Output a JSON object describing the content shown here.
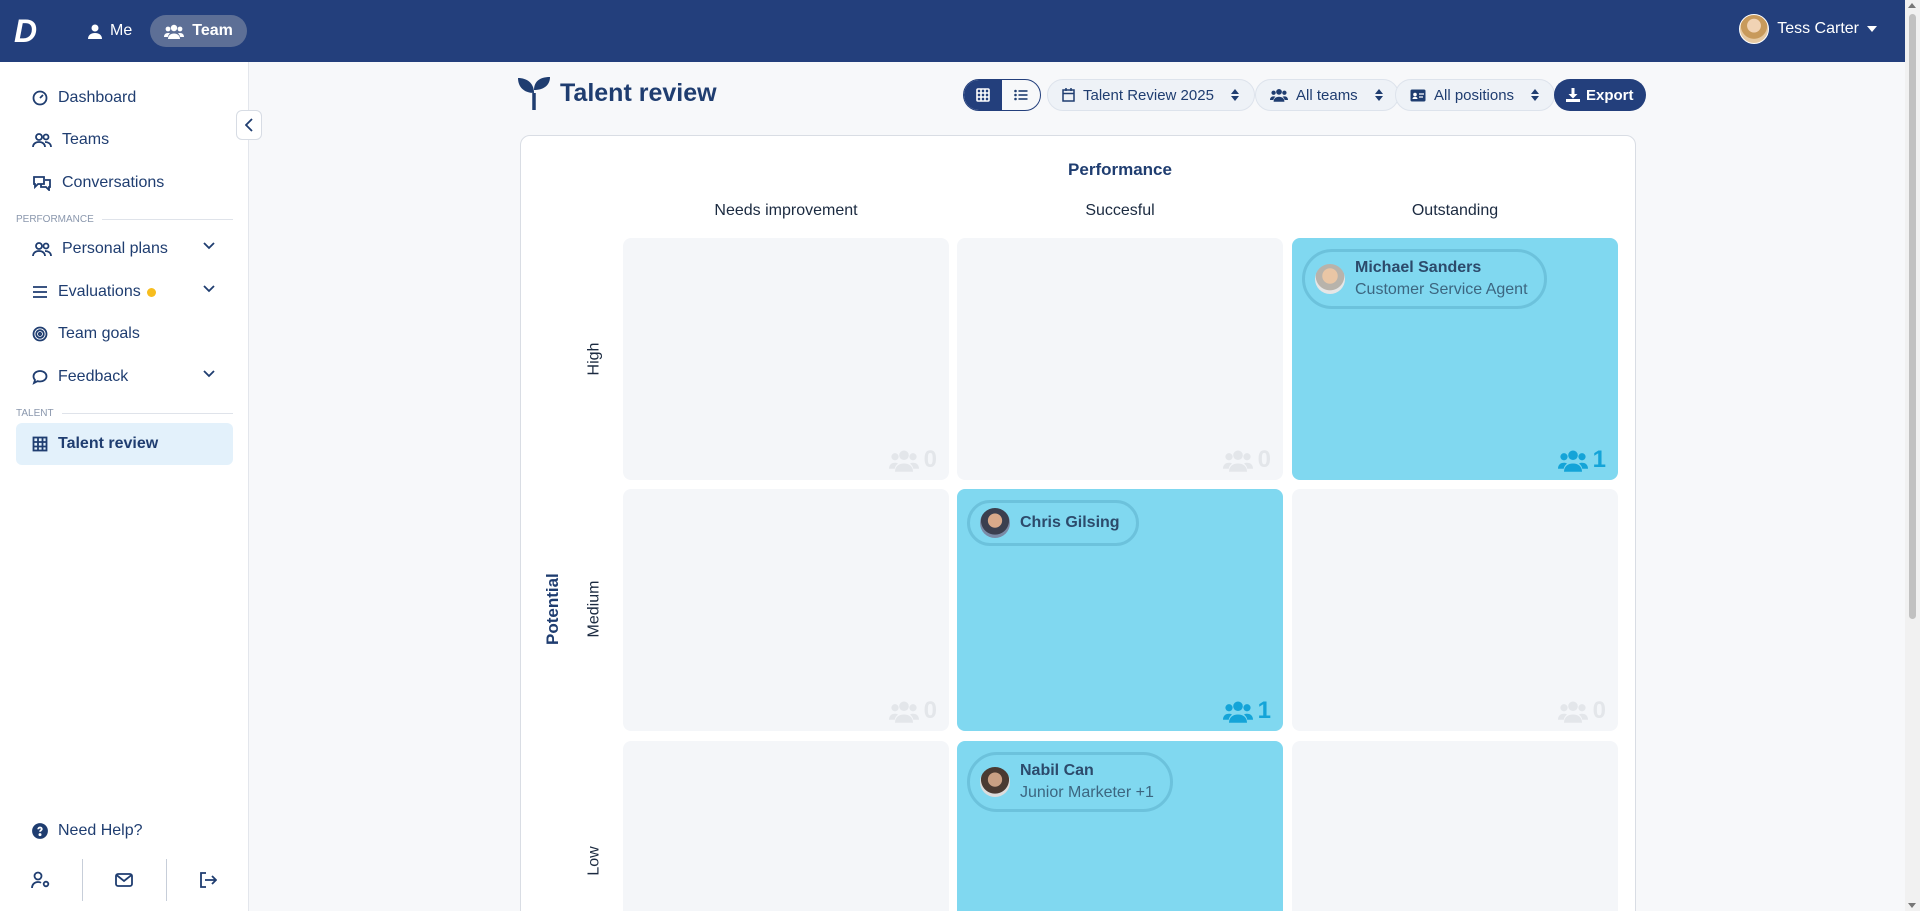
{
  "topbar": {
    "logo": "D",
    "nav": [
      {
        "label": "Me"
      },
      {
        "label": "Team"
      }
    ],
    "user_name": "Tess Carter"
  },
  "sidebar": {
    "items": [
      {
        "label": "Dashboard",
        "icon": "dashboard-icon"
      },
      {
        "label": "Teams",
        "icon": "teams-icon"
      },
      {
        "label": "Conversations",
        "icon": "conversations-icon"
      }
    ],
    "section_performance": "PERFORMANCE",
    "performance_items": [
      {
        "label": "Personal plans",
        "icon": "personal-plans-icon",
        "expandable": true
      },
      {
        "label": "Evaluations",
        "icon": "list-icon",
        "expandable": true,
        "notification": true
      },
      {
        "label": "Team goals",
        "icon": "target-icon"
      },
      {
        "label": "Feedback",
        "icon": "chat-icon",
        "expandable": true
      }
    ],
    "section_talent": "TALENT",
    "talent_items": [
      {
        "label": "Talent review",
        "icon": "grid-icon",
        "active": true
      }
    ],
    "help_label": "Need Help?"
  },
  "main": {
    "title": "Talent review",
    "filters": {
      "cycle": "Talent Review 2025",
      "teams": "All teams",
      "positions": "All positions",
      "export_label": "Export"
    },
    "matrix": {
      "x_axis_label": "Performance",
      "y_axis_label": "Potential",
      "columns": [
        "Needs improvement",
        "Succesful",
        "Outstanding"
      ],
      "rows": [
        "High",
        "Medium",
        "Low"
      ],
      "cells": {
        "high": [
          {
            "count": "0",
            "people": []
          },
          {
            "count": "0",
            "people": []
          },
          {
            "count": "1",
            "people": [
              {
                "name": "Michael Sanders",
                "role": "Customer Service Agent"
              }
            ]
          }
        ],
        "medium": [
          {
            "count": "0",
            "people": []
          },
          {
            "count": "1",
            "people": [
              {
                "name": "Chris Gilsing",
                "role": ""
              }
            ]
          },
          {
            "count": "0",
            "people": []
          }
        ],
        "low": [
          {
            "count": "",
            "people": []
          },
          {
            "count": "",
            "people": [
              {
                "name": "Nabil Can",
                "role": "Junior Marketer +1"
              }
            ]
          },
          {
            "count": "",
            "people": []
          }
        ]
      }
    }
  },
  "colors": {
    "topbar": "#233f7c",
    "filled_cell": "#80d8f0",
    "empty_cell": "#f4f6f9",
    "count_active": "#14a4d8",
    "notification_dot": "#f7bd1e"
  }
}
